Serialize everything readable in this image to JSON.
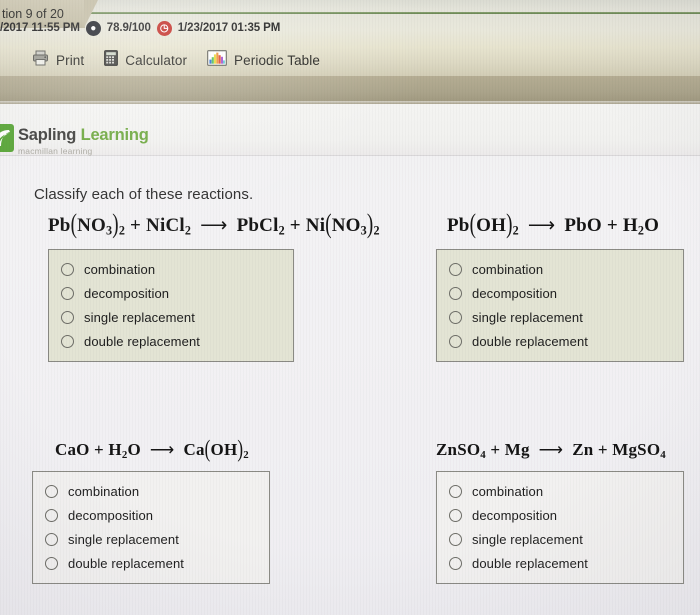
{
  "topbar": {
    "timestamp_left": "/2017 11:55 PM",
    "score_icon": "score-badge-icon",
    "score": "78.9/100",
    "clock_icon": "clock-icon",
    "timestamp_right": "1/23/2017 01:35 PM",
    "tools": [
      {
        "icon": "printer-icon",
        "label": "Print"
      },
      {
        "icon": "calculator-icon",
        "label": "Calculator"
      },
      {
        "icon": "periodic-table-icon",
        "label": "Periodic Table"
      }
    ]
  },
  "tab": {
    "label": "tion 9 of 20"
  },
  "brand": {
    "logo_icon": "sapling-leaf-logo-icon",
    "name_part1": "Sapling",
    "name_part2": "Learning",
    "tagline": "macmillan learning",
    "green": "#6aa63a"
  },
  "prompt": "Classify each of these reactions.",
  "options": [
    "combination",
    "decomposition",
    "single replacement",
    "double replacement"
  ],
  "problems": [
    {
      "id": "p1",
      "equation_plain": "Pb(NO3)2 + NiCl2 → PbCl2 + Ni(NO3)2",
      "left": [
        {
          "t": "Pb"
        },
        {
          "t": "(",
          "p": true
        },
        {
          "t": "NO"
        },
        {
          "t": "3",
          "s": true
        },
        {
          "t": ")",
          "p": true
        },
        {
          "t": "2",
          "s": true
        },
        {
          "t": " + "
        },
        {
          "t": "NiCl"
        },
        {
          "t": "2",
          "s": true
        }
      ],
      "right": [
        {
          "t": "PbCl"
        },
        {
          "t": "2",
          "s": true
        },
        {
          "t": " + "
        },
        {
          "t": "Ni"
        },
        {
          "t": "(",
          "p": true
        },
        {
          "t": "NO"
        },
        {
          "t": "3",
          "s": true
        },
        {
          "t": ")",
          "p": true
        },
        {
          "t": "2",
          "s": true
        }
      ],
      "box_style": "tint"
    },
    {
      "id": "p2",
      "equation_plain": "Pb(OH)2 → PbO + H2O",
      "left": [
        {
          "t": "Pb"
        },
        {
          "t": "(",
          "p": true
        },
        {
          "t": "OH"
        },
        {
          "t": ")",
          "p": true
        },
        {
          "t": "2",
          "s": true
        }
      ],
      "right": [
        {
          "t": "PbO + H"
        },
        {
          "t": "2",
          "s": true
        },
        {
          "t": "O"
        }
      ],
      "box_style": "tint"
    },
    {
      "id": "p3",
      "equation_plain": "CaO + H2O → Ca(OH)2",
      "left": [
        {
          "t": "CaO + H"
        },
        {
          "t": "2",
          "s": true
        },
        {
          "t": "O"
        }
      ],
      "right": [
        {
          "t": "Ca"
        },
        {
          "t": "(",
          "p": true
        },
        {
          "t": "OH"
        },
        {
          "t": ")",
          "p": true
        },
        {
          "t": "2",
          "s": true
        }
      ],
      "box_style": "plain"
    },
    {
      "id": "p4",
      "equation_plain": "ZnSO4 + Mg → Zn + MgSO4",
      "left": [
        {
          "t": "ZnSO"
        },
        {
          "t": "4",
          "s": true
        },
        {
          "t": " + Mg"
        }
      ],
      "right": [
        {
          "t": "Zn + MgSO"
        },
        {
          "t": "4",
          "s": true
        }
      ],
      "box_style": "plain"
    }
  ],
  "arrow_glyph": "⟶"
}
